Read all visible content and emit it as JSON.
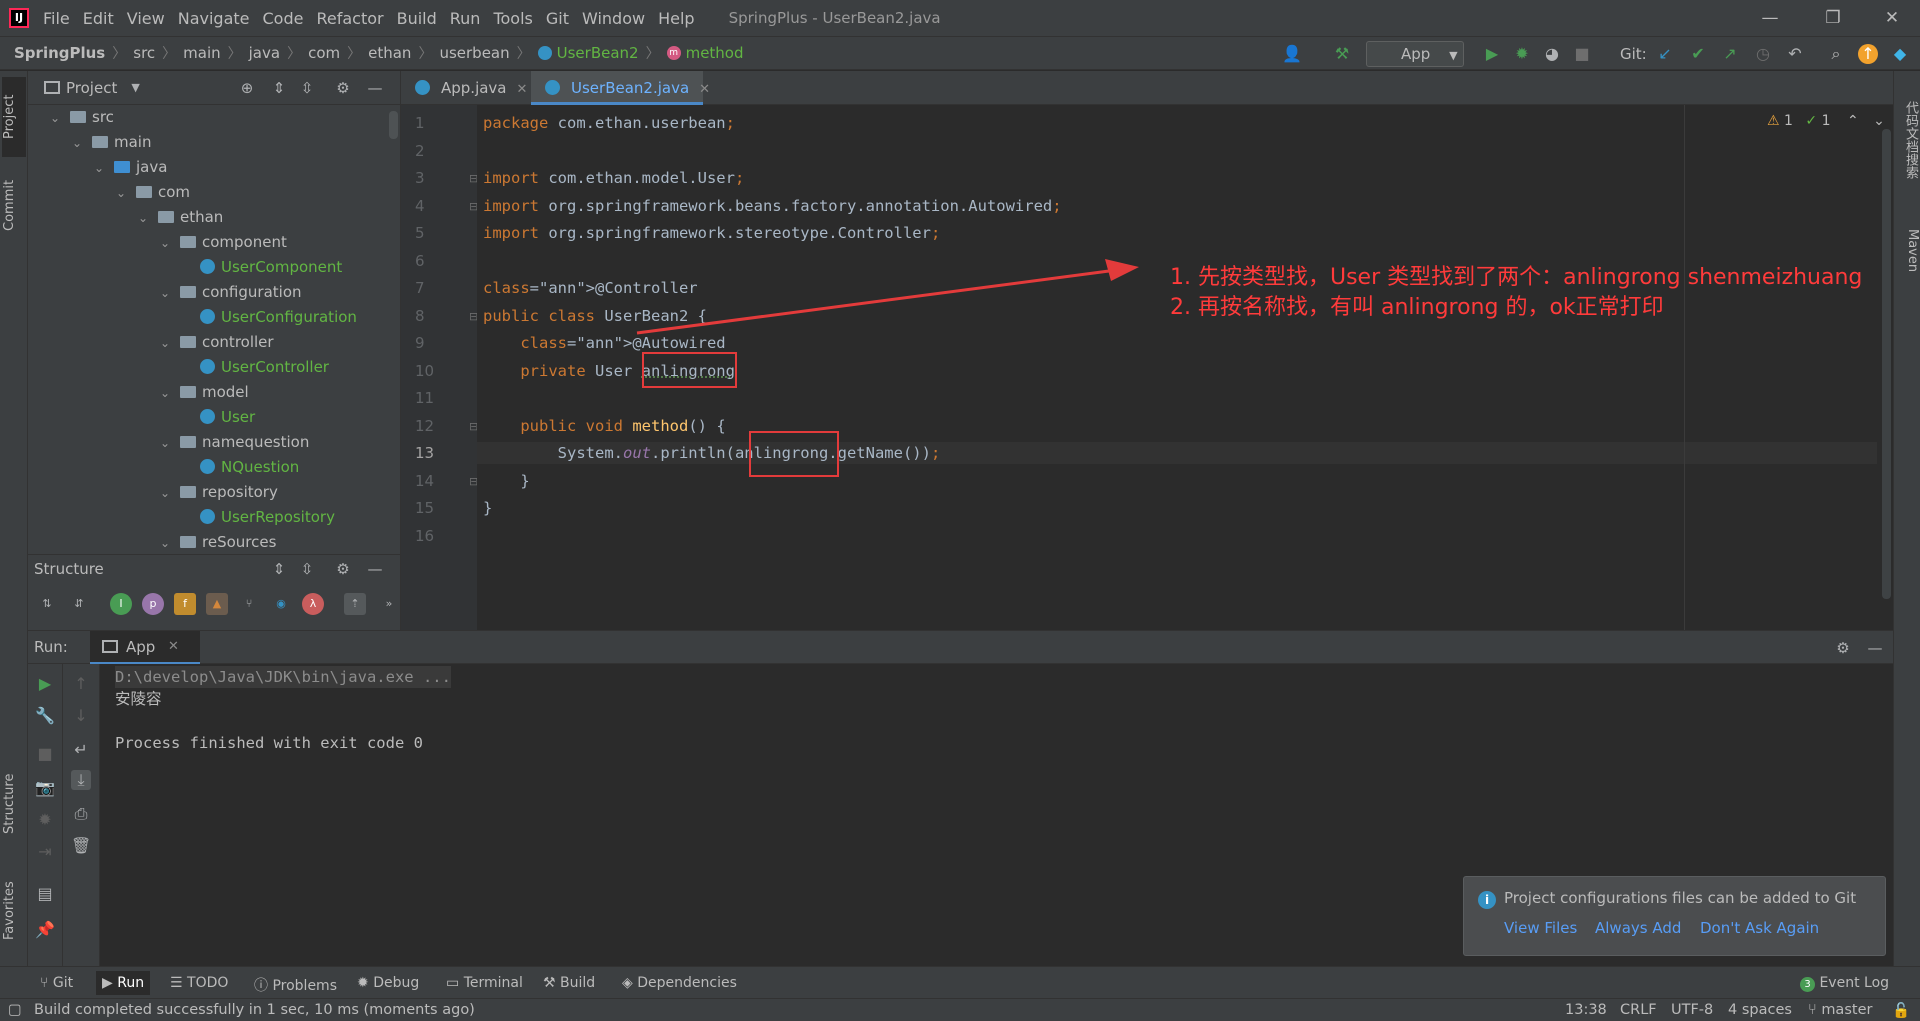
{
  "window": {
    "title": "SpringPlus - UserBean2.java",
    "menu": [
      "File",
      "Edit",
      "View",
      "Navigate",
      "Code",
      "Refactor",
      "Build",
      "Run",
      "Tools",
      "Git",
      "Window",
      "Help"
    ],
    "logo_text": "IJ"
  },
  "navbar": {
    "breadcrumbs": [
      "SpringPlus",
      "src",
      "main",
      "java",
      "com",
      "ethan",
      "userbean",
      "UserBean2",
      "method"
    ],
    "run_config": "App",
    "git_label": "Git:"
  },
  "left_strip": {
    "tabs": [
      "Project",
      "Commit",
      "Structure",
      "Favorites"
    ]
  },
  "right_strip": {
    "tabs": [
      "代码文档搜索",
      "Maven"
    ]
  },
  "project_panel": {
    "title": "Project",
    "tree": [
      {
        "label": "src",
        "depth": 0,
        "kind": "folder"
      },
      {
        "label": "main",
        "depth": 1,
        "kind": "folder"
      },
      {
        "label": "java",
        "depth": 2,
        "kind": "folder-blue"
      },
      {
        "label": "com",
        "depth": 3,
        "kind": "folder"
      },
      {
        "label": "ethan",
        "depth": 4,
        "kind": "folder"
      },
      {
        "label": "component",
        "depth": 5,
        "kind": "folder"
      },
      {
        "label": "UserComponent",
        "depth": 6,
        "kind": "class"
      },
      {
        "label": "configuration",
        "depth": 5,
        "kind": "folder"
      },
      {
        "label": "UserConfiguration",
        "depth": 6,
        "kind": "class"
      },
      {
        "label": "controller",
        "depth": 5,
        "kind": "folder"
      },
      {
        "label": "UserController",
        "depth": 6,
        "kind": "class"
      },
      {
        "label": "model",
        "depth": 5,
        "kind": "folder"
      },
      {
        "label": "User",
        "depth": 6,
        "kind": "class"
      },
      {
        "label": "namequestion",
        "depth": 5,
        "kind": "folder"
      },
      {
        "label": "NQuestion",
        "depth": 6,
        "kind": "class"
      },
      {
        "label": "repository",
        "depth": 5,
        "kind": "folder"
      },
      {
        "label": "UserRepository",
        "depth": 6,
        "kind": "class"
      },
      {
        "label": "reSources",
        "depth": 5,
        "kind": "folder"
      }
    ]
  },
  "structure_panel": {
    "title": "Structure",
    "filters": [
      "I",
      "p",
      "f",
      "▲",
      "λ"
    ]
  },
  "editor": {
    "tabs": [
      {
        "label": "App.java",
        "active": false
      },
      {
        "label": "UserBean2.java",
        "active": true
      }
    ],
    "inspections": {
      "warnings": "1",
      "checks": "1"
    },
    "current_line": 13,
    "lines": [
      "package com.ethan.userbean;",
      "",
      "import com.ethan.model.User;",
      "import org.springframework.beans.factory.annotation.Autowired;",
      "import org.springframework.stereotype.Controller;",
      "",
      "@Controller",
      "public class UserBean2 {",
      "    @Autowired",
      "    private User anlingrong",
      "",
      "    public void method() {",
      "        System.out.println(anlingrong.getName());",
      "    }",
      "}",
      ""
    ],
    "annotations": [
      "1. 先按类型找，User 类型找到了两个：anlingrong  shenmeizhuang",
      "2. 再按名称找，有叫 anlingrong 的，ok正常打印"
    ]
  },
  "run_panel": {
    "label": "Run:",
    "tab": "App",
    "console": [
      "D:\\develop\\Java\\JDK\\bin\\java.exe ...",
      "安陵容",
      "",
      "Process finished with exit code 0"
    ]
  },
  "notification": {
    "message": "Project configurations files can be added to Git",
    "actions": [
      "View Files",
      "Always Add",
      "Don't Ask Again"
    ]
  },
  "toolwindow_bar": {
    "items": [
      "Git",
      "Run",
      "TODO",
      "Problems",
      "Debug",
      "Terminal",
      "Build",
      "Dependencies"
    ],
    "active": "Run",
    "event_log": "Event Log",
    "event_count": "3"
  },
  "statusbar": {
    "message": "Build completed successfully in 1 sec, 10 ms (moments ago)",
    "position": "13:38",
    "line_sep": "CRLF",
    "encoding": "UTF-8",
    "indent": "4 spaces",
    "branch": "master"
  },
  "colors": {
    "accent": "#4a88c7",
    "annotation_red": "#ff3b3b",
    "run_green": "#499c54"
  }
}
